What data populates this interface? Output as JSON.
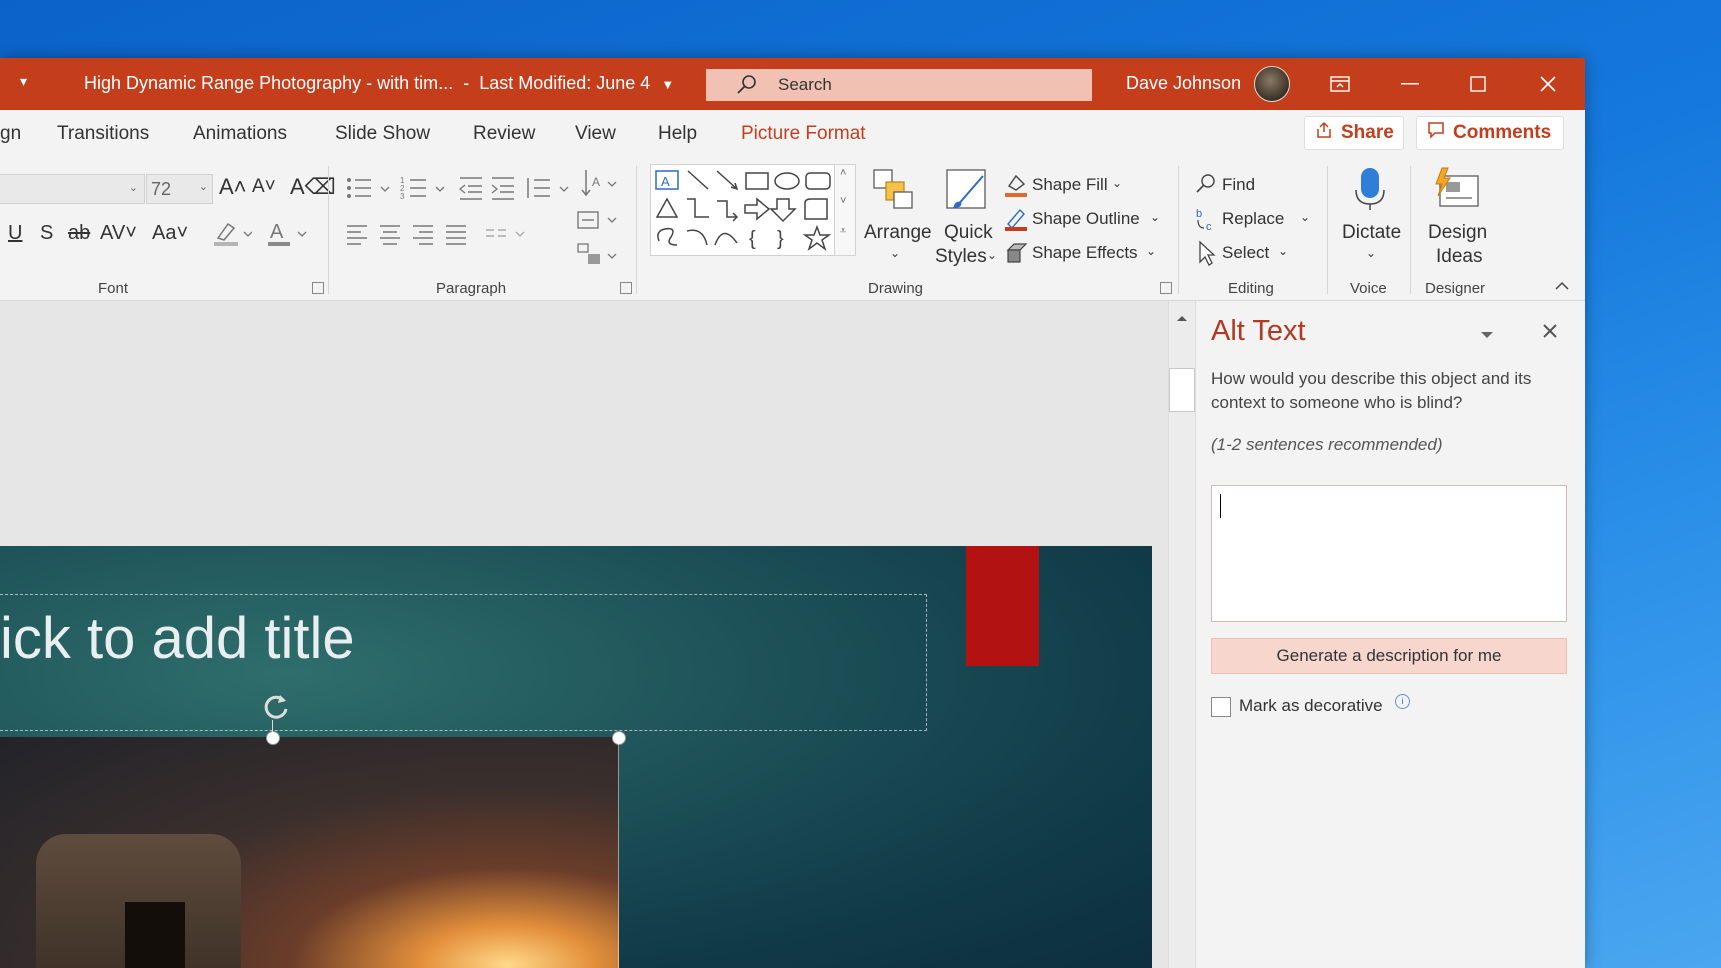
{
  "window": {
    "doc_title": "High Dynamic Range Photography - with tim...",
    "separator": "-",
    "last_modified": "Last Modified: June 4",
    "search_placeholder": "Search",
    "user_name": "Dave Johnson"
  },
  "tabs": [
    {
      "label": "gn"
    },
    {
      "label": "Transitions"
    },
    {
      "label": "Animations"
    },
    {
      "label": "Slide Show"
    },
    {
      "label": "Review"
    },
    {
      "label": "View"
    },
    {
      "label": "Help"
    },
    {
      "label": "Picture Format"
    }
  ],
  "actions": {
    "share": "Share",
    "comments": "Comments"
  },
  "ribbon": {
    "font": {
      "label": "Font",
      "size": "72"
    },
    "paragraph": {
      "label": "Paragraph"
    },
    "drawing": {
      "label": "Drawing",
      "arrange": "Arrange",
      "quick_styles_1": "Quick",
      "quick_styles_2": "Styles",
      "shape_fill": "Shape Fill",
      "shape_outline": "Shape Outline",
      "shape_effects": "Shape Effects"
    },
    "editing": {
      "label": "Editing",
      "find": "Find",
      "replace": "Replace",
      "select": "Select"
    },
    "voice": {
      "label": "Voice",
      "dictate": "Dictate"
    },
    "designer": {
      "label": "Designer",
      "design_1": "Design",
      "design_2": "Ideas"
    }
  },
  "slide": {
    "title_placeholder": "ick to add title"
  },
  "alt_text_pane": {
    "title": "Alt Text",
    "question": "How would you describe this object and its context to someone who is blind?",
    "hint": "(1-2 sentences recommended)",
    "generate_button": "Generate a description for me",
    "decorative_label": "Mark as decorative"
  },
  "colors": {
    "accent": "#c43e1c",
    "pane_title": "#b03a22",
    "generate_bg": "#f6d6cd",
    "red_shape": "#b31212"
  }
}
